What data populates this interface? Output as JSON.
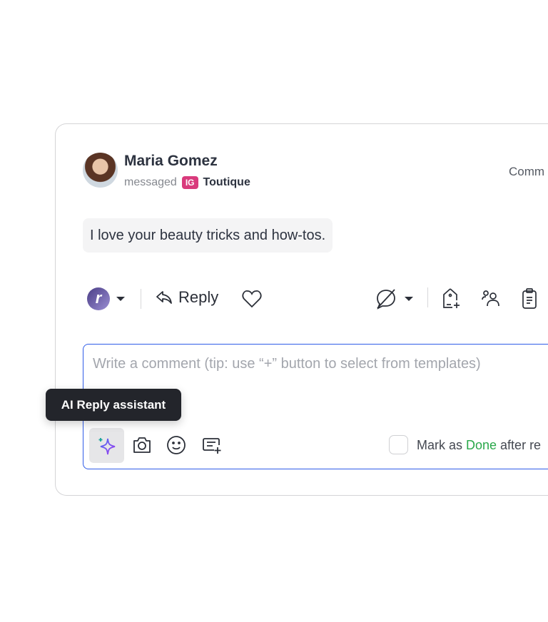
{
  "post": {
    "author": "Maria Gomez",
    "action": "messaged",
    "platform_badge": "IG",
    "account": "Toutique",
    "right_label": "Comm",
    "message": "I love your beauty tricks and how-tos."
  },
  "actions": {
    "brand_logo_letter": "r",
    "reply_label": "Reply"
  },
  "composer": {
    "placeholder": "Write a comment (tip: use “+” button to select from templates)",
    "mark_prefix": "Mark as ",
    "mark_done": "Done",
    "mark_suffix": " after re",
    "tooltip": "AI Reply assistant"
  },
  "colors": {
    "accent": "#2f5ce8",
    "done": "#2aa84a",
    "ig": "#d93a7c"
  }
}
